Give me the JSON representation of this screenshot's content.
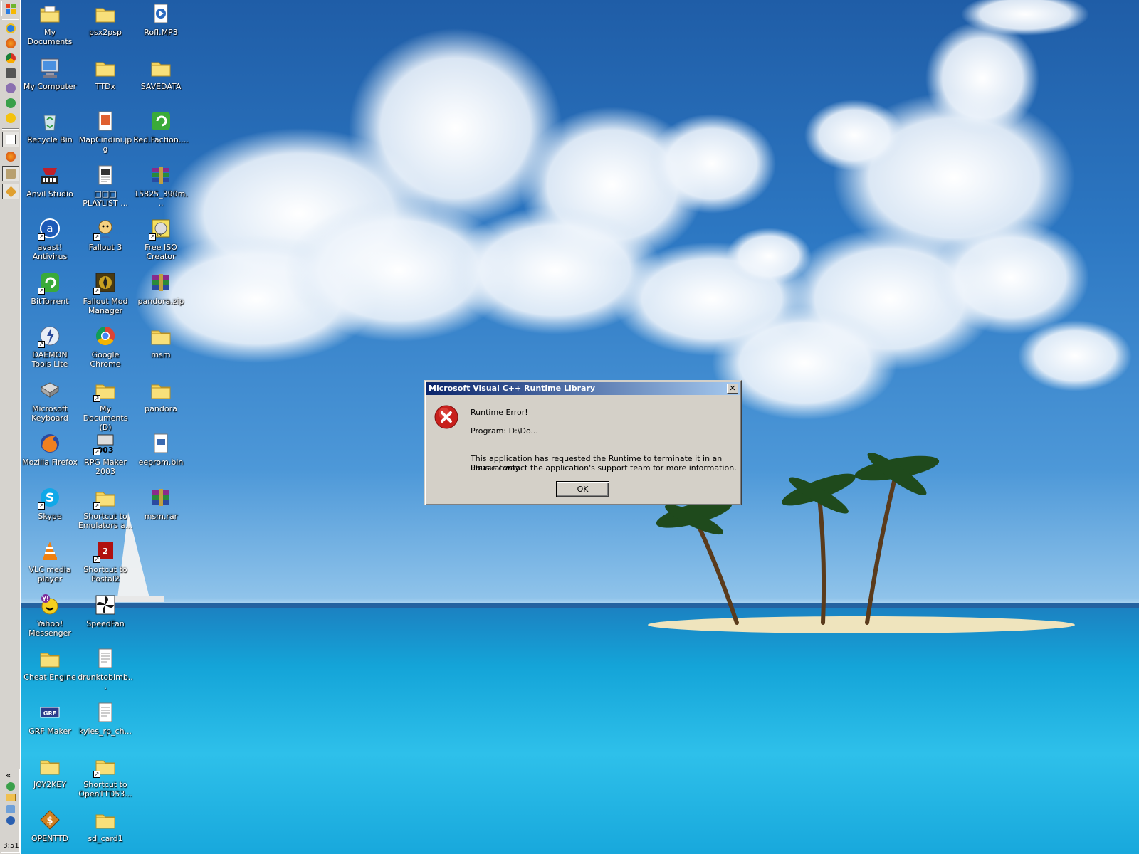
{
  "dialog": {
    "title": "Microsoft Visual C++ Runtime Library",
    "close_glyph": "✕",
    "heading": "Runtime Error!",
    "program": "Program: D:\\Do...",
    "message_line1": "This application has requested the Runtime to terminate it in an unusual way.",
    "message_line2": "Please contact the application's support team for more information.",
    "ok_label": "OK"
  },
  "taskbar": {
    "clock": "3:51",
    "quick_launch": [
      "windows-logo-icon",
      "ie-icon",
      "firefox-icon",
      "chrome-icon",
      "daemon-icon",
      "pidgin-icon",
      "msn-icon",
      "yahoo-icon"
    ],
    "tasks": [
      "calendar-icon",
      "firefox-icon",
      "app-icon",
      "diamond-icon"
    ],
    "tray_expand": "«"
  },
  "desktop": {
    "columns": [
      [
        {
          "label": "My Documents",
          "icon": "folder-documents-icon"
        },
        {
          "label": "My Computer",
          "icon": "computer-icon"
        },
        {
          "label": "Recycle Bin",
          "icon": "recycle-bin-icon"
        },
        {
          "label": "Anvil Studio",
          "icon": "anvil-studio-icon"
        },
        {
          "label": "avast! Antivirus",
          "icon": "avast-icon",
          "shortcut": true
        },
        {
          "label": "BitTorrent",
          "icon": "bittorrent-icon",
          "shortcut": true
        },
        {
          "label": "DAEMON Tools Lite",
          "icon": "daemon-tools-icon",
          "shortcut": true
        },
        {
          "label": "Microsoft Keyboard",
          "icon": "keyboard-icon"
        },
        {
          "label": "Mozilla Firefox",
          "icon": "firefox-icon"
        },
        {
          "label": "Skype",
          "icon": "skype-icon",
          "shortcut": true
        },
        {
          "label": "VLC media player",
          "icon": "vlc-icon"
        },
        {
          "label": "Yahoo! Messenger",
          "icon": "yahoo-messenger-icon"
        },
        {
          "label": "Cheat Engine",
          "icon": "folder-icon"
        },
        {
          "label": "GRF Maker",
          "icon": "grf-maker-icon"
        },
        {
          "label": "JOY2KEY",
          "icon": "folder-icon"
        },
        {
          "label": "OPENTTD",
          "icon": "openttd-icon"
        }
      ],
      [
        {
          "label": "psx2psp",
          "icon": "folder-icon"
        },
        {
          "label": "TTDx",
          "icon": "folder-icon"
        },
        {
          "label": "MapCindini.jpg",
          "icon": "image-file-icon"
        },
        {
          "label": "□□□ PLAYLIST ...",
          "icon": "playlist-file-icon"
        },
        {
          "label": "Fallout 3",
          "icon": "fallout3-icon",
          "shortcut": true
        },
        {
          "label": "Fallout Mod Manager",
          "icon": "fallout-mod-manager-icon",
          "shortcut": true
        },
        {
          "label": "Google Chrome",
          "icon": "chrome-icon"
        },
        {
          "label": "My Documents (D)",
          "icon": "folder-icon",
          "shortcut": true
        },
        {
          "label": "RPG Maker 2003",
          "icon": "rpg-maker-icon",
          "shortcut": true
        },
        {
          "label": "Shortcut to Emulators a...",
          "icon": "folder-icon",
          "shortcut": true
        },
        {
          "label": "Shortcut to Postal2",
          "icon": "postal2-icon",
          "shortcut": true
        },
        {
          "label": "SpeedFan",
          "icon": "speedfan-icon"
        },
        {
          "label": "drunktobimb...",
          "icon": "text-file-icon"
        },
        {
          "label": "kyles_rp_ch...",
          "icon": "text-file-icon"
        },
        {
          "label": "Shortcut to OpenTTD53...",
          "icon": "folder-icon",
          "shortcut": true
        },
        {
          "label": "sd_card1",
          "icon": "folder-icon"
        }
      ],
      [
        {
          "label": "Rofl.MP3",
          "icon": "media-file-icon"
        },
        {
          "label": "SAVEDATA",
          "icon": "folder-icon"
        },
        {
          "label": "Red.Faction....",
          "icon": "bittorrent-file-icon"
        },
        {
          "label": "15825_390m...",
          "icon": "winrar-archive-icon"
        },
        {
          "label": "Free ISO Creator",
          "icon": "iso-creator-icon",
          "shortcut": true
        },
        {
          "label": "pandora.zip",
          "icon": "winrar-archive-icon"
        },
        {
          "label": "msm",
          "icon": "folder-icon"
        },
        {
          "label": "pandora",
          "icon": "folder-icon"
        },
        {
          "label": "eeprom.bin",
          "icon": "binary-file-icon"
        },
        {
          "label": "msm.rar",
          "icon": "winrar-archive-icon"
        }
      ]
    ]
  }
}
